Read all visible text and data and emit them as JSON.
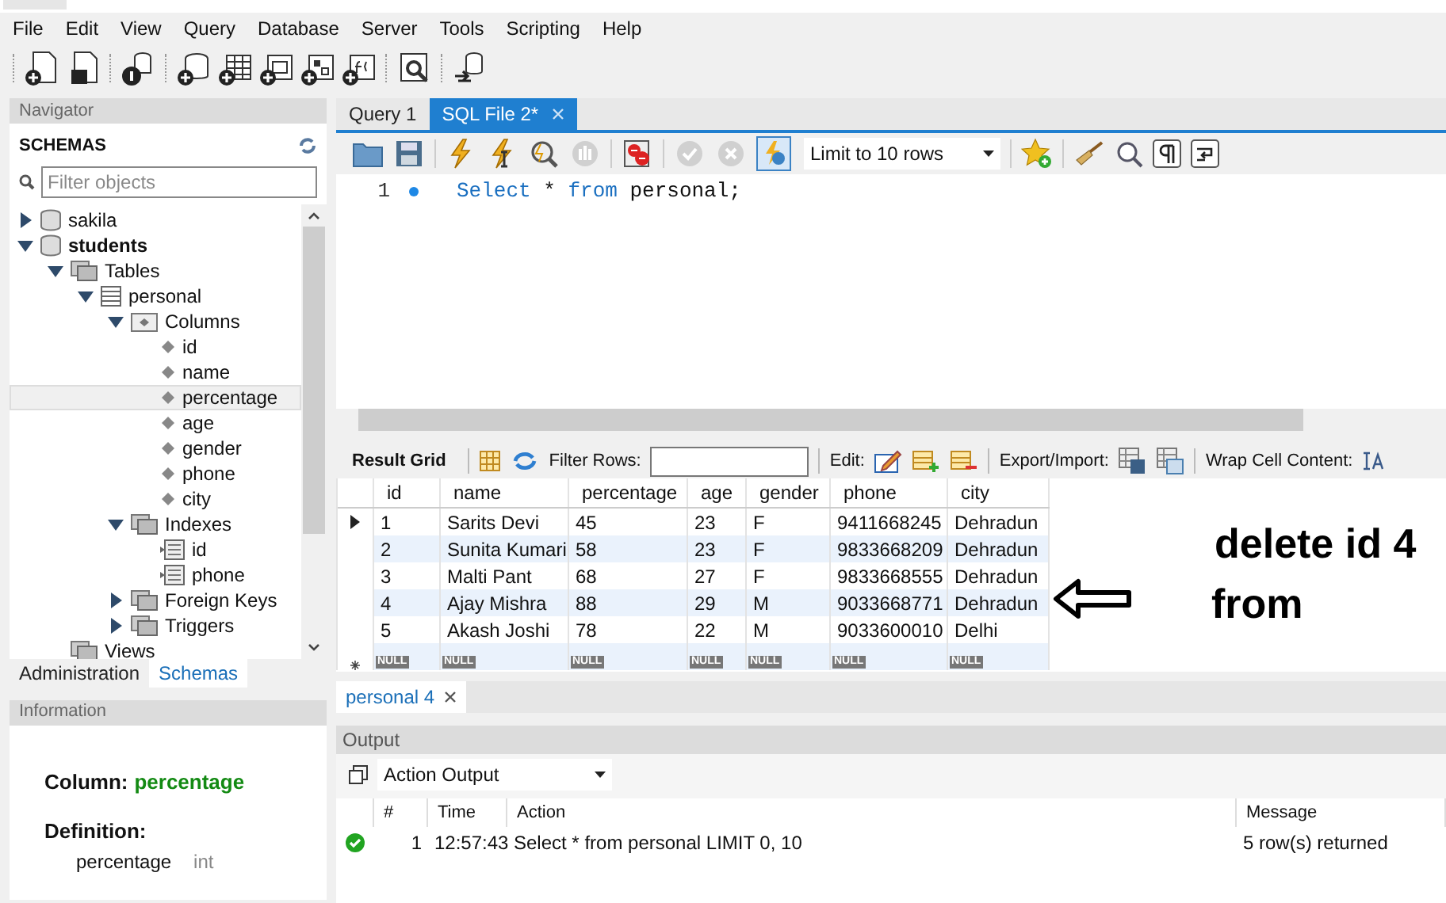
{
  "menu": [
    "File",
    "Edit",
    "View",
    "Query",
    "Database",
    "Server",
    "Tools",
    "Scripting",
    "Help"
  ],
  "navigator": {
    "title": "Navigator",
    "schemas_label": "SCHEMAS",
    "filter_placeholder": "Filter objects",
    "tree": [
      {
        "label": "sakila",
        "kind": "schema",
        "expanded": false,
        "default": false,
        "selected": false
      },
      {
        "label": "students",
        "kind": "schema",
        "expanded": true,
        "default": true,
        "selected": false,
        "children": [
          {
            "label": "Tables",
            "kind": "folder",
            "expanded": true,
            "selected": false,
            "children": [
              {
                "label": "personal",
                "kind": "table",
                "expanded": true,
                "selected": false,
                "children": [
                  {
                    "label": "Columns",
                    "kind": "columns",
                    "expanded": true,
                    "selected": false,
                    "children": [
                      {
                        "label": "id",
                        "kind": "column",
                        "selected": false
                      },
                      {
                        "label": "name",
                        "kind": "column",
                        "selected": false
                      },
                      {
                        "label": "percentage",
                        "kind": "column",
                        "selected": true
                      },
                      {
                        "label": "age",
                        "kind": "column",
                        "selected": false
                      },
                      {
                        "label": "gender",
                        "kind": "column",
                        "selected": false
                      },
                      {
                        "label": "phone",
                        "kind": "column",
                        "selected": false
                      },
                      {
                        "label": "city",
                        "kind": "column",
                        "selected": false
                      }
                    ]
                  },
                  {
                    "label": "Indexes",
                    "kind": "folder",
                    "expanded": true,
                    "selected": false,
                    "children": [
                      {
                        "label": "id",
                        "kind": "index",
                        "selected": false
                      },
                      {
                        "label": "phone",
                        "kind": "index",
                        "selected": false
                      }
                    ]
                  },
                  {
                    "label": "Foreign Keys",
                    "kind": "folder",
                    "expanded": false,
                    "selected": false
                  },
                  {
                    "label": "Triggers",
                    "kind": "folder",
                    "expanded": false,
                    "selected": false
                  }
                ]
              }
            ]
          },
          {
            "label": "Views",
            "kind": "folder",
            "selected": false
          }
        ]
      }
    ],
    "bottom_tabs": [
      {
        "label": "Administration",
        "selected": false
      },
      {
        "label": "Schemas",
        "selected": true
      }
    ]
  },
  "information": {
    "title": "Information",
    "column_label": "Column:",
    "column_value": "percentage",
    "definition_label": "Definition:",
    "definition_name": "percentage",
    "definition_type": "int"
  },
  "editor": {
    "tabs": [
      {
        "label": "Query 1",
        "selected": false
      },
      {
        "label": "SQL File 2*",
        "selected": true
      }
    ],
    "limit": "Limit to 10 rows",
    "lines": [
      {
        "number": "1",
        "tokens": [
          {
            "text": "Select",
            "kind": "keyword"
          },
          {
            "text": " * ",
            "kind": "plain"
          },
          {
            "text": "from",
            "kind": "keyword"
          },
          {
            "text": " personal;",
            "kind": "plain"
          }
        ]
      }
    ]
  },
  "result": {
    "grid_label": "Result Grid",
    "filter_label": "Filter Rows:",
    "edit_label": "Edit:",
    "export_label": "Export/Import:",
    "wrap_label": "Wrap Cell Content:",
    "columns": [
      "id",
      "name",
      "percentage",
      "age",
      "gender",
      "phone",
      "city"
    ],
    "rows": [
      {
        "current": true,
        "cells": [
          "1",
          "Sarits Devi",
          "45",
          "23",
          "F",
          "9411668245",
          "Dehradun"
        ]
      },
      {
        "current": false,
        "cells": [
          "2",
          "Sunita Kumari",
          "58",
          "23",
          "F",
          "9833668209",
          "Dehradun"
        ]
      },
      {
        "current": false,
        "cells": [
          "3",
          "Malti Pant",
          "68",
          "27",
          "F",
          "9833668555",
          "Dehradun"
        ]
      },
      {
        "current": false,
        "cells": [
          "4",
          "Ajay Mishra",
          "88",
          "29",
          "M",
          "9033668771",
          "Dehradun"
        ]
      },
      {
        "current": false,
        "cells": [
          "5",
          "Akash Joshi",
          "78",
          "22",
          "M",
          "9033600010",
          "Delhi"
        ]
      }
    ],
    "new_row": [
      "NULL",
      "NULL",
      "NULL",
      "NULL",
      "NULL",
      "NULL",
      "NULL"
    ]
  },
  "annotation": {
    "lines": [
      "delete id 4",
      "from"
    ]
  },
  "result_tabs": [
    {
      "label": "personal 4",
      "selected": true
    }
  ],
  "output": {
    "title": "Output",
    "selector": "Action Output",
    "columns": [
      "#",
      "Time",
      "Action",
      "Message"
    ],
    "rows": [
      {
        "succeeded": true,
        "number": "1",
        "time": "12:57:43",
        "action": "Select * from personal LIMIT 0, 10",
        "message": "5 row(s) returned"
      }
    ]
  }
}
